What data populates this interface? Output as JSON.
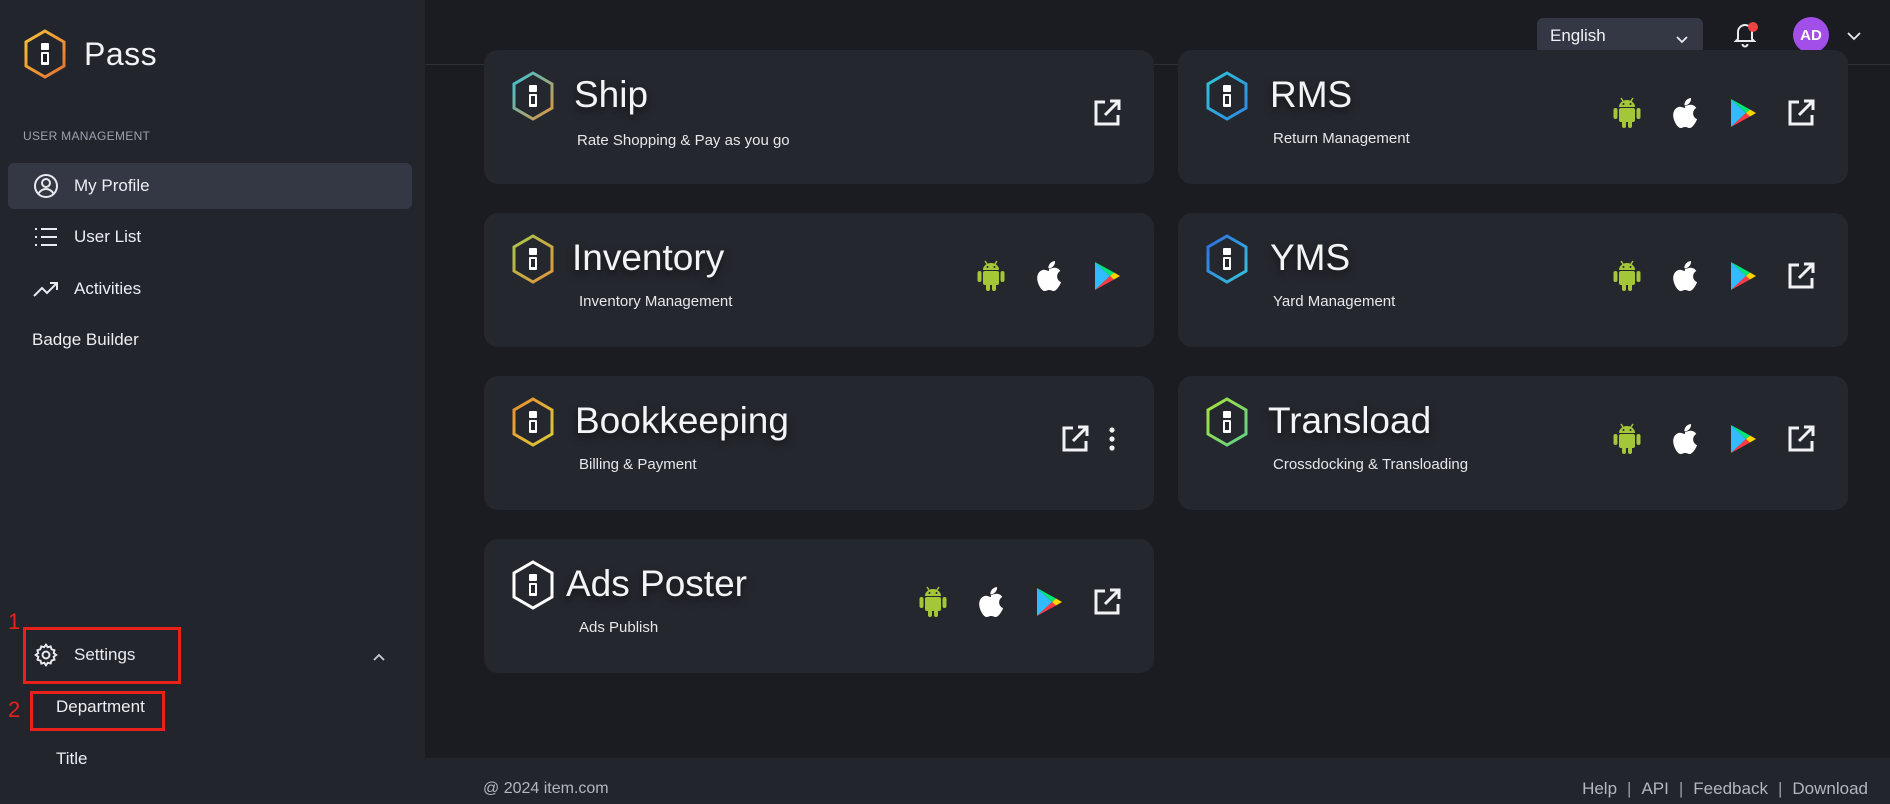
{
  "app": {
    "name": "Pass"
  },
  "sidebar": {
    "section_label": "USER MANAGEMENT",
    "items": [
      {
        "label": "My Profile",
        "icon": "user-circle-icon",
        "active": true
      },
      {
        "label": "User List",
        "icon": "list-icon"
      },
      {
        "label": "Activities",
        "icon": "trending-up-icon"
      },
      {
        "label": "Badge Builder"
      }
    ],
    "settings": {
      "label": "Settings",
      "icon": "gear-icon",
      "expanded": true,
      "children": [
        {
          "label": "Department"
        },
        {
          "label": "Title"
        }
      ]
    }
  },
  "annotations": [
    {
      "number": "1",
      "color": "#e8221b"
    },
    {
      "number": "2",
      "color": "#e8221b"
    }
  ],
  "header": {
    "language": "English",
    "notification_dot_color": "#f04444",
    "avatar": {
      "initials": "AD",
      "color": "#a24ee8"
    }
  },
  "apps": [
    {
      "title": "Ship",
      "subtitle": "Rate Shopping & Pay as you go",
      "actions": [
        "external-link-icon"
      ],
      "colors": [
        "#39c3d6",
        "#e1963e"
      ]
    },
    {
      "title": "RMS",
      "subtitle": "Return Management",
      "actions": [
        "android-icon",
        "apple-icon",
        "google-play-icon",
        "external-link-icon"
      ],
      "colors": [
        "#2fc7d6",
        "#2e87e6"
      ]
    },
    {
      "title": "Inventory",
      "subtitle": "Inventory Management",
      "actions": [
        "android-icon",
        "apple-icon",
        "google-play-icon"
      ],
      "colors": [
        "#a7c64a",
        "#e1963e"
      ]
    },
    {
      "title": "YMS",
      "subtitle": "Yard Management",
      "actions": [
        "android-icon",
        "apple-icon",
        "google-play-icon",
        "external-link-icon"
      ],
      "colors": [
        "#2d6be0",
        "#36c7dc"
      ]
    },
    {
      "title": "Bookkeeping",
      "subtitle": "Billing & Payment",
      "actions": [
        "external-link-icon",
        "more-vertical-icon"
      ],
      "colors": [
        "#e8902f",
        "#dccb3a"
      ]
    },
    {
      "title": "Transload",
      "subtitle": "Crossdocking & Transloading",
      "actions": [
        "android-icon",
        "apple-icon",
        "google-play-icon",
        "external-link-icon"
      ],
      "colors": [
        "#a9e23a",
        "#5ed18c"
      ]
    },
    {
      "title": "Ads Poster",
      "subtitle": "Ads Publish",
      "actions": [
        "android-icon",
        "apple-icon",
        "google-play-icon",
        "external-link-icon"
      ],
      "colors": [
        "#ffffff",
        "#ffffff"
      ]
    }
  ],
  "footer": {
    "copyright": "@ 2024 item.com",
    "links": [
      "Help",
      "API",
      "Feedback",
      "Download"
    ]
  }
}
